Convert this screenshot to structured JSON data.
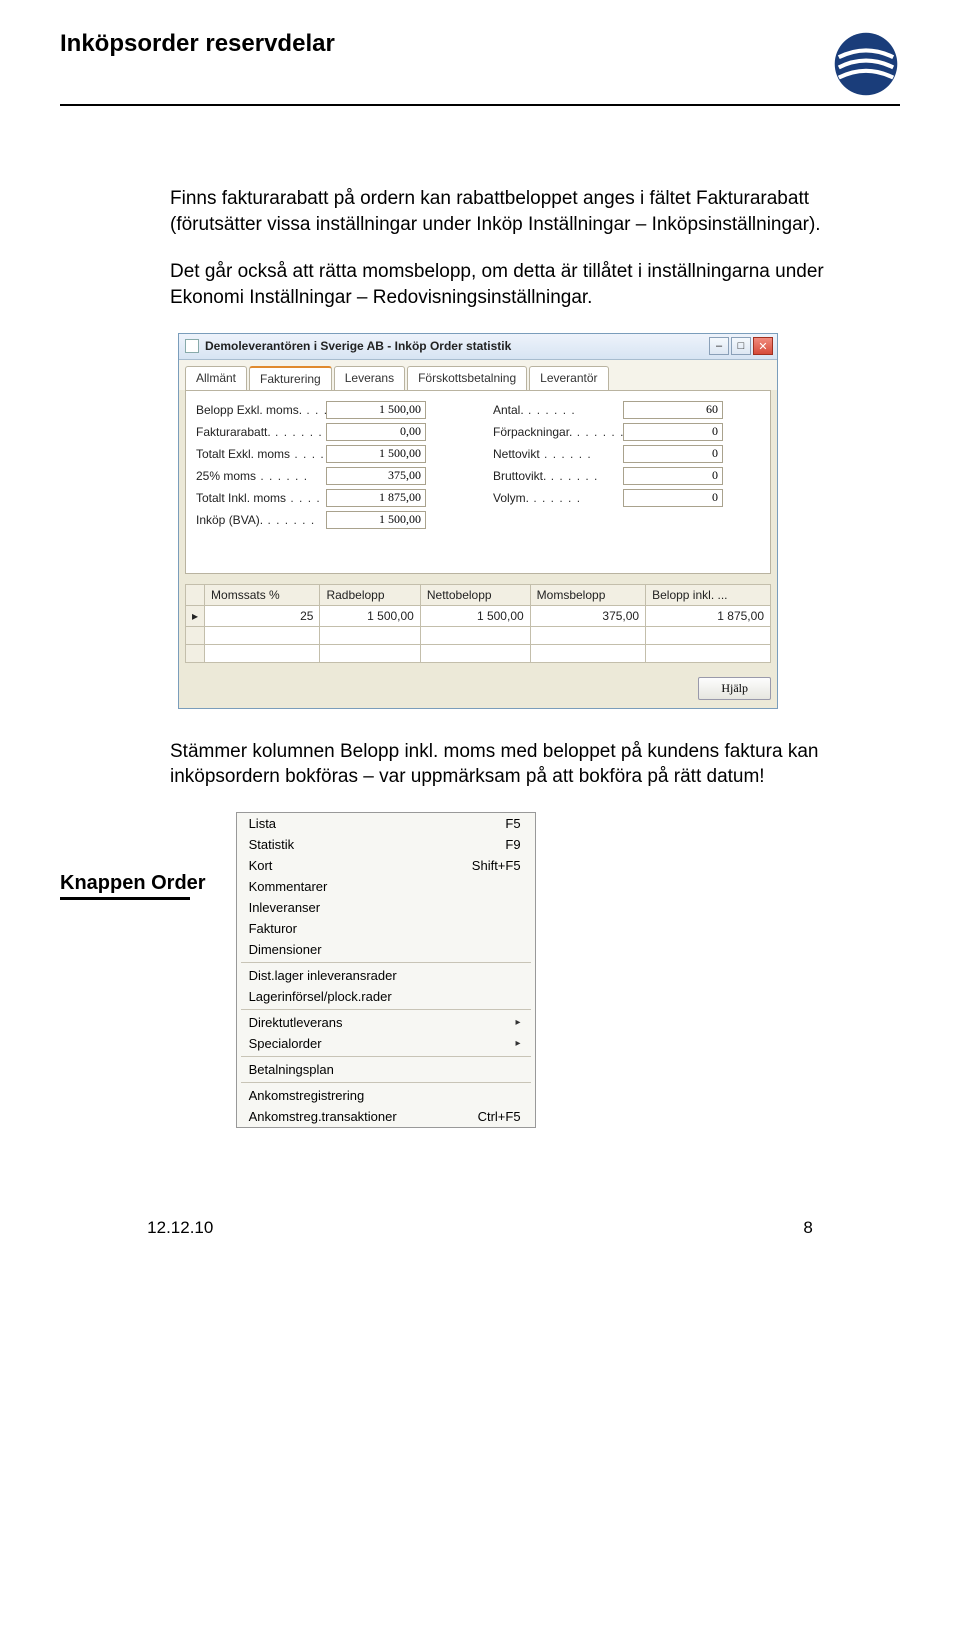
{
  "header": {
    "title": "Inköpsorder reservdelar"
  },
  "paragraphs": {
    "p1": "Finns fakturarabatt på ordern kan rabattbeloppet anges i fältet Fakturarabatt (förutsätter vissa inställningar under Inköp Inställningar – Inköpsinställningar).",
    "p2": "Det går också att rätta momsbelopp, om detta är tillåtet i inställningarna under Ekonomi Inställningar – Redovisningsinställningar.",
    "p3": "Stämmer kolumnen Belopp inkl. moms med beloppet på kundens faktura kan inköpsordern bokföras – var uppmärksam på att bokföra på rätt datum!"
  },
  "dialog": {
    "title": "Demoleverantören i Sverige AB - Inköp Order statistik",
    "tabs": [
      "Allmänt",
      "Fakturering",
      "Leverans",
      "Förskottsbetalning",
      "Leverantör"
    ],
    "active_tab_index": 1,
    "left_fields": [
      {
        "label": "Belopp Exkl. moms.",
        "value": "1 500,00"
      },
      {
        "label": "Fakturarabatt.",
        "value": "0,00"
      },
      {
        "label": "Totalt Exkl. moms",
        "value": "1 500,00"
      },
      {
        "label": "25% moms",
        "value": "375,00"
      },
      {
        "label": "Totalt Inkl. moms",
        "value": "1 875,00"
      },
      {
        "label": "Inköp (BVA).",
        "value": "1 500,00"
      }
    ],
    "right_fields": [
      {
        "label": "Antal.",
        "value": "60"
      },
      {
        "label": "Förpackningar.",
        "value": "0"
      },
      {
        "label": "Nettovikt",
        "value": "0"
      },
      {
        "label": "Bruttovikt.",
        "value": "0"
      },
      {
        "label": "Volym.",
        "value": "0"
      }
    ],
    "table": {
      "columns": [
        "Momssats %",
        "Radbelopp",
        "Nettobelopp",
        "Momsbelopp",
        "Belopp inkl. ..."
      ],
      "rows": [
        [
          "25",
          "1 500,00",
          "1 500,00",
          "375,00",
          "1 875,00"
        ]
      ]
    },
    "help_label": "Hjälp"
  },
  "section": {
    "title": "Knappen Order"
  },
  "menu": {
    "groups": [
      [
        {
          "label": "Lista",
          "shortcut": "F5"
        },
        {
          "label": "Statistik",
          "shortcut": "F9"
        },
        {
          "label": "Kort",
          "shortcut": "Shift+F5"
        },
        {
          "label": "Kommentarer",
          "shortcut": ""
        },
        {
          "label": "Inleveranser",
          "shortcut": ""
        },
        {
          "label": "Fakturor",
          "shortcut": ""
        },
        {
          "label": "Dimensioner",
          "shortcut": ""
        }
      ],
      [
        {
          "label": "Dist.lager inleveransrader",
          "shortcut": ""
        },
        {
          "label": "Lagerinförsel/plock.rader",
          "shortcut": ""
        }
      ],
      [
        {
          "label": "Direktutleverans",
          "shortcut": "",
          "submenu": true
        },
        {
          "label": "Specialorder",
          "shortcut": "",
          "submenu": true
        }
      ],
      [
        {
          "label": "Betalningsplan",
          "shortcut": ""
        }
      ],
      [
        {
          "label": "Ankomstregistrering",
          "shortcut": ""
        },
        {
          "label": "Ankomstreg.transaktioner",
          "shortcut": "Ctrl+F5"
        }
      ]
    ]
  },
  "footer": {
    "date": "12.12.10",
    "page": "8"
  }
}
